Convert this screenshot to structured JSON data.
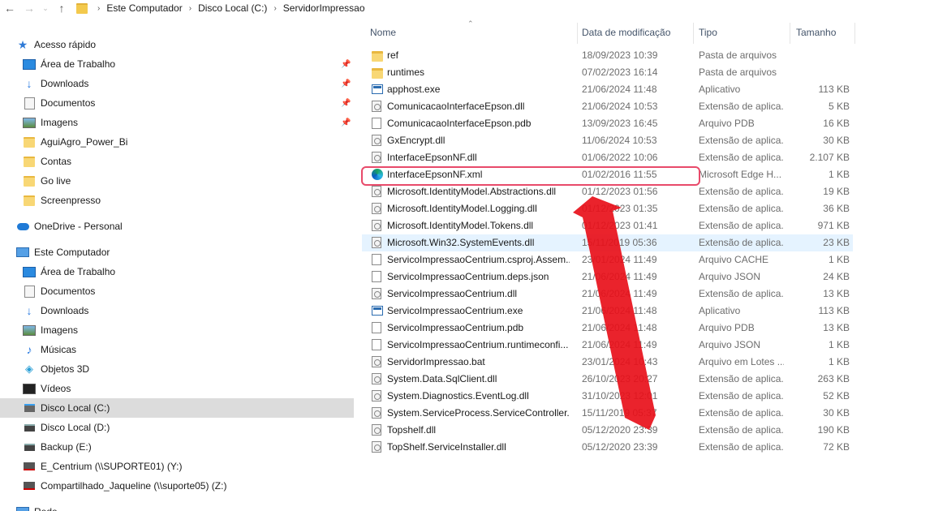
{
  "address_bar": {
    "crumbs": [
      "Este Computador",
      "Disco Local (C:)",
      "ServidorImpressao"
    ]
  },
  "sidebar": {
    "items": [
      {
        "label": "Acesso rápido",
        "icon": "star-icon",
        "pinned": false,
        "selected": false
      },
      {
        "label": "Área de Trabalho",
        "icon": "desktop-icon",
        "pinned": true,
        "selected": false
      },
      {
        "label": "Downloads",
        "icon": "download-icon",
        "pinned": true,
        "selected": false
      },
      {
        "label": "Documentos",
        "icon": "document-icon",
        "pinned": true,
        "selected": false
      },
      {
        "label": "Imagens",
        "icon": "pictures-icon",
        "pinned": true,
        "selected": false
      },
      {
        "label": "AguiAgro_Power_Bi",
        "icon": "folder-icon",
        "pinned": false,
        "selected": false
      },
      {
        "label": "Contas",
        "icon": "folder-icon",
        "pinned": false,
        "selected": false
      },
      {
        "label": "Go live",
        "icon": "folder-icon",
        "pinned": false,
        "selected": false
      },
      {
        "label": "Screenpresso",
        "icon": "folder-icon",
        "pinned": false,
        "selected": false
      },
      {
        "label": "OneDrive - Personal",
        "icon": "cloud-icon",
        "pinned": false,
        "selected": false
      },
      {
        "label": "Este Computador",
        "icon": "computer-icon",
        "pinned": false,
        "selected": false
      },
      {
        "label": "Área de Trabalho",
        "icon": "desktop-icon",
        "pinned": false,
        "selected": false
      },
      {
        "label": "Documentos",
        "icon": "document-icon",
        "pinned": false,
        "selected": false
      },
      {
        "label": "Downloads",
        "icon": "download-icon",
        "pinned": false,
        "selected": false
      },
      {
        "label": "Imagens",
        "icon": "pictures-icon",
        "pinned": false,
        "selected": false
      },
      {
        "label": "Músicas",
        "icon": "music-icon",
        "pinned": false,
        "selected": false
      },
      {
        "label": "Objetos 3D",
        "icon": "objects-3d-icon",
        "pinned": false,
        "selected": false
      },
      {
        "label": "Vídeos",
        "icon": "video-icon",
        "pinned": false,
        "selected": false
      },
      {
        "label": "Disco Local (C:)",
        "icon": "system-drive-icon",
        "pinned": false,
        "selected": true
      },
      {
        "label": "Disco Local (D:)",
        "icon": "drive-icon",
        "pinned": false,
        "selected": false
      },
      {
        "label": "Backup (E:)",
        "icon": "drive-icon",
        "pinned": false,
        "selected": false
      },
      {
        "label": "E_Centrium (\\\\SUPORTE01) (Y:)",
        "icon": "network-drive-icon",
        "pinned": false,
        "selected": false
      },
      {
        "label": "Compartilhado_Jaqueline (\\\\suporte05) (Z:)",
        "icon": "network-drive-icon",
        "pinned": false,
        "selected": false
      },
      {
        "label": "Rede",
        "icon": "network-icon",
        "pinned": false,
        "selected": false
      }
    ]
  },
  "columns": {
    "name": "Nome",
    "date": "Data de modificação",
    "type": "Tipo",
    "size": "Tamanho"
  },
  "files": [
    {
      "name": "ref",
      "date": "18/09/2023 10:39",
      "type": "Pasta de arquivos",
      "size": "",
      "icon": "folder"
    },
    {
      "name": "runtimes",
      "date": "07/02/2023 16:14",
      "type": "Pasta de arquivos",
      "size": "",
      "icon": "folder"
    },
    {
      "name": "apphost.exe",
      "date": "21/06/2024 11:48",
      "type": "Aplicativo",
      "size": "113 KB",
      "icon": "exe"
    },
    {
      "name": "ComunicacaoInterfaceEpson.dll",
      "date": "21/06/2024 10:53",
      "type": "Extensão de aplica...",
      "size": "5 KB",
      "icon": "dll"
    },
    {
      "name": "ComunicacaoInterfaceEpson.pdb",
      "date": "13/09/2023 16:45",
      "type": "Arquivo PDB",
      "size": "16 KB",
      "icon": "doc"
    },
    {
      "name": "GxEncrypt.dll",
      "date": "11/06/2024 10:53",
      "type": "Extensão de aplica...",
      "size": "30 KB",
      "icon": "dll"
    },
    {
      "name": "InterfaceEpsonNF.dll",
      "date": "01/06/2022 10:06",
      "type": "Extensão de aplica...",
      "size": "2.107 KB",
      "icon": "dll"
    },
    {
      "name": "InterfaceEpsonNF.xml",
      "date": "01/02/2016 11:55",
      "type": "Microsoft Edge H...",
      "size": "1 KB",
      "icon": "edge"
    },
    {
      "name": "Microsoft.IdentityModel.Abstractions.dll",
      "date": "01/12/2023 01:56",
      "type": "Extensão de aplica...",
      "size": "19 KB",
      "icon": "dll"
    },
    {
      "name": "Microsoft.IdentityModel.Logging.dll",
      "date": "01/12/2023 01:35",
      "type": "Extensão de aplica...",
      "size": "36 KB",
      "icon": "dll"
    },
    {
      "name": "Microsoft.IdentityModel.Tokens.dll",
      "date": "01/12/2023 01:41",
      "type": "Extensão de aplica...",
      "size": "971 KB",
      "icon": "dll"
    },
    {
      "name": "Microsoft.Win32.SystemEvents.dll",
      "date": "15/11/2019 05:36",
      "type": "Extensão de aplica...",
      "size": "23 KB",
      "icon": "dll"
    },
    {
      "name": "ServicoImpressaoCentrium.csproj.Assem...",
      "date": "23/01/2024 11:49",
      "type": "Arquivo CACHE",
      "size": "1 KB",
      "icon": "doc"
    },
    {
      "name": "ServicoImpressaoCentrium.deps.json",
      "date": "21/06/2024 11:49",
      "type": "Arquivo JSON",
      "size": "24 KB",
      "icon": "doc"
    },
    {
      "name": "ServicoImpressaoCentrium.dll",
      "date": "21/06/2024 11:49",
      "type": "Extensão de aplica...",
      "size": "13 KB",
      "icon": "dll"
    },
    {
      "name": "ServicoImpressaoCentrium.exe",
      "date": "21/06/2024 11:48",
      "type": "Aplicativo",
      "size": "113 KB",
      "icon": "exe"
    },
    {
      "name": "ServicoImpressaoCentrium.pdb",
      "date": "21/06/2024 11:48",
      "type": "Arquivo PDB",
      "size": "13 KB",
      "icon": "doc"
    },
    {
      "name": "ServicoImpressaoCentrium.runtimeconfi...",
      "date": "21/06/2024 11:49",
      "type": "Arquivo JSON",
      "size": "1 KB",
      "icon": "doc"
    },
    {
      "name": "ServidorImpressao.bat",
      "date": "23/01/2024 10:43",
      "type": "Arquivo em Lotes ...",
      "size": "1 KB",
      "icon": "dll"
    },
    {
      "name": "System.Data.SqlClient.dll",
      "date": "26/10/2023 20:27",
      "type": "Extensão de aplica...",
      "size": "263 KB",
      "icon": "dll"
    },
    {
      "name": "System.Diagnostics.EventLog.dll",
      "date": "31/10/2023 12:01",
      "type": "Extensão de aplica...",
      "size": "52 KB",
      "icon": "dll"
    },
    {
      "name": "System.ServiceProcess.ServiceController....",
      "date": "15/11/2019 05:37",
      "type": "Extensão de aplica...",
      "size": "30 KB",
      "icon": "dll"
    },
    {
      "name": "Topshelf.dll",
      "date": "05/12/2020 23:39",
      "type": "Extensão de aplica...",
      "size": "190 KB",
      "icon": "dll"
    },
    {
      "name": "TopShelf.ServiceInstaller.dll",
      "date": "05/12/2020 23:39",
      "type": "Extensão de aplica...",
      "size": "72 KB",
      "icon": "dll"
    }
  ],
  "annotation": {
    "highlighted_file": "InterfaceEpsonNF.xml",
    "highlight_color": "#e84a6a",
    "arrow_color": "#e8101a"
  }
}
